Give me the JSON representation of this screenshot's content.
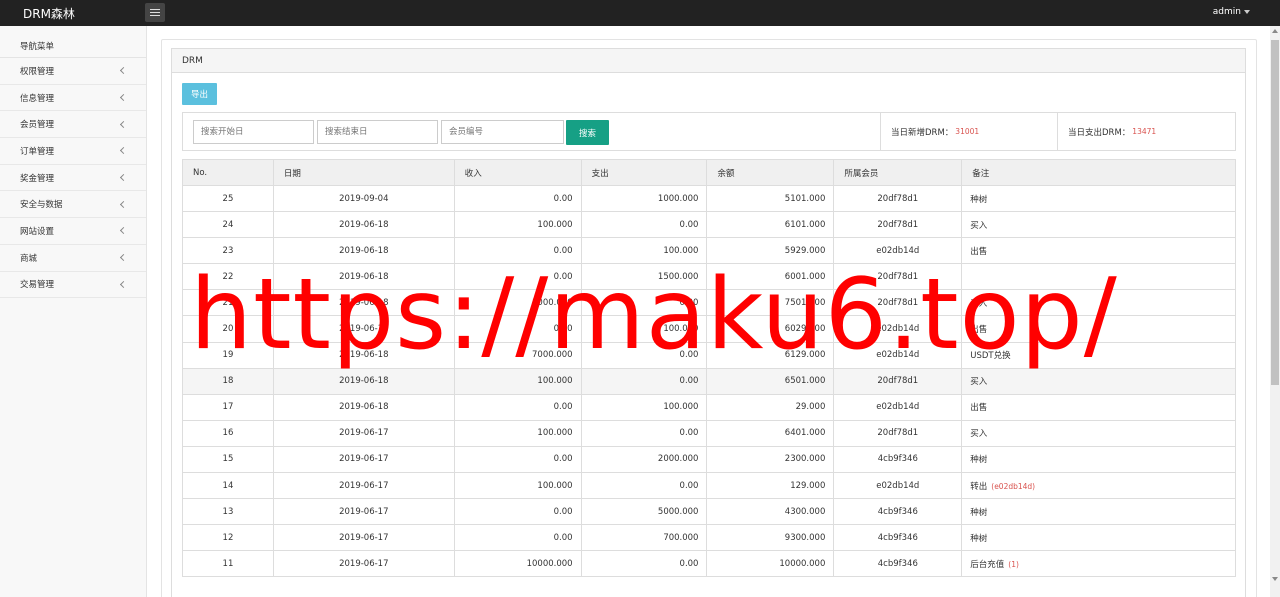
{
  "header": {
    "brand": "DRM森林",
    "user": "admin"
  },
  "sidebar": {
    "title": "导航菜单",
    "items": [
      {
        "label": "权限管理"
      },
      {
        "label": "信息管理"
      },
      {
        "label": "会员管理"
      },
      {
        "label": "订单管理"
      },
      {
        "label": "奖金管理"
      },
      {
        "label": "安全与数据"
      },
      {
        "label": "网站设置"
      },
      {
        "label": "商城"
      },
      {
        "label": "交易管理"
      }
    ]
  },
  "panel": {
    "title": "DRM",
    "export_label": "导出"
  },
  "search": {
    "start_placeholder": "搜索开始日",
    "end_placeholder": "搜索结束日",
    "member_placeholder": "会员编号",
    "button_label": "搜索"
  },
  "stats": {
    "new_label": "当日新增DRM：",
    "new_value": "31001",
    "out_label": "当日支出DRM：",
    "out_value": "13471"
  },
  "table": {
    "headers": [
      "No.",
      "日期",
      "收入",
      "支出",
      "余额",
      "所属会员",
      "备注"
    ],
    "rows": [
      {
        "no": "25",
        "date": "2019-09-04",
        "income": "0.00",
        "expense": "1000.000",
        "balance": "5101.000",
        "member": "20df78d1",
        "note": "种树",
        "note_extra": ""
      },
      {
        "no": "24",
        "date": "2019-06-18",
        "income": "100.000",
        "expense": "0.00",
        "balance": "6101.000",
        "member": "20df78d1",
        "note": "买入",
        "note_extra": ""
      },
      {
        "no": "23",
        "date": "2019-06-18",
        "income": "0.00",
        "expense": "100.000",
        "balance": "5929.000",
        "member": "e02db14d",
        "note": "出售",
        "note_extra": ""
      },
      {
        "no": "22",
        "date": "2019-06-18",
        "income": "0.00",
        "expense": "1500.000",
        "balance": "6001.000",
        "member": "20df78d1",
        "note": "",
        "note_extra": ""
      },
      {
        "no": "21",
        "date": "2019-06-18",
        "income": "1000.000",
        "expense": "0.00",
        "balance": "7501.000",
        "member": "20df78d1",
        "note": "买入",
        "note_extra": ""
      },
      {
        "no": "20",
        "date": "2019-06-18",
        "income": "0.00",
        "expense": "100.000",
        "balance": "6029.000",
        "member": "e02db14d",
        "note": "出售",
        "note_extra": ""
      },
      {
        "no": "19",
        "date": "2019-06-18",
        "income": "7000.000",
        "expense": "0.00",
        "balance": "6129.000",
        "member": "e02db14d",
        "note": "USDT兑换",
        "note_extra": ""
      },
      {
        "no": "18",
        "date": "2019-06-18",
        "income": "100.000",
        "expense": "0.00",
        "balance": "6501.000",
        "member": "20df78d1",
        "note": "买入",
        "note_extra": ""
      },
      {
        "no": "17",
        "date": "2019-06-18",
        "income": "0.00",
        "expense": "100.000",
        "balance": "29.000",
        "member": "e02db14d",
        "note": "出售",
        "note_extra": ""
      },
      {
        "no": "16",
        "date": "2019-06-17",
        "income": "100.000",
        "expense": "0.00",
        "balance": "6401.000",
        "member": "20df78d1",
        "note": "买入",
        "note_extra": ""
      },
      {
        "no": "15",
        "date": "2019-06-17",
        "income": "0.00",
        "expense": "2000.000",
        "balance": "2300.000",
        "member": "4cb9f346",
        "note": "种树",
        "note_extra": ""
      },
      {
        "no": "14",
        "date": "2019-06-17",
        "income": "100.000",
        "expense": "0.00",
        "balance": "129.000",
        "member": "e02db14d",
        "note": "转出",
        "note_extra": "(e02db14d)"
      },
      {
        "no": "13",
        "date": "2019-06-17",
        "income": "0.00",
        "expense": "5000.000",
        "balance": "4300.000",
        "member": "4cb9f346",
        "note": "种树",
        "note_extra": ""
      },
      {
        "no": "12",
        "date": "2019-06-17",
        "income": "0.00",
        "expense": "700.000",
        "balance": "9300.000",
        "member": "4cb9f346",
        "note": "种树",
        "note_extra": ""
      },
      {
        "no": "11",
        "date": "2019-06-17",
        "income": "10000.000",
        "expense": "0.00",
        "balance": "10000.000",
        "member": "4cb9f346",
        "note": "后台充值",
        "note_extra": "(1)"
      }
    ]
  },
  "watermark": "https://maku6.top/",
  "colors": {
    "topbar": "#222222",
    "export": "#5bc0de",
    "search": "#16a085",
    "highlight": "#d9534f",
    "watermark": "#ff0000"
  }
}
